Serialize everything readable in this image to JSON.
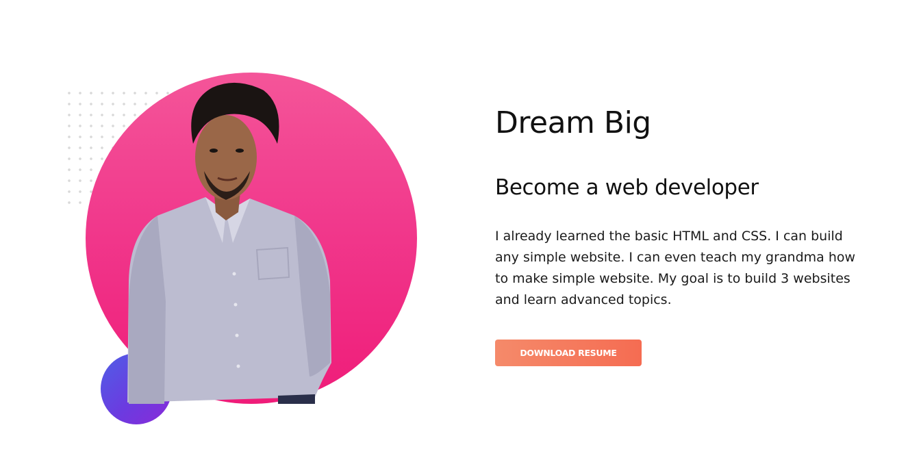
{
  "hero": {
    "title": "Dream Big",
    "subtitle": "Become a web developer",
    "description": "I already learned the basic HTML and CSS. I can build any simple website. I can even teach my grandma how to make simple website. My goal is to build 3 websites and learn advanced topics.",
    "button_label": "DOWNLOAD RESUME"
  },
  "colors": {
    "main_circle": "#f1398c",
    "accent_circle": "#6b3be0",
    "button": "#f56c52",
    "text": "#111111"
  },
  "image": {
    "subject": "portrait-photo"
  }
}
